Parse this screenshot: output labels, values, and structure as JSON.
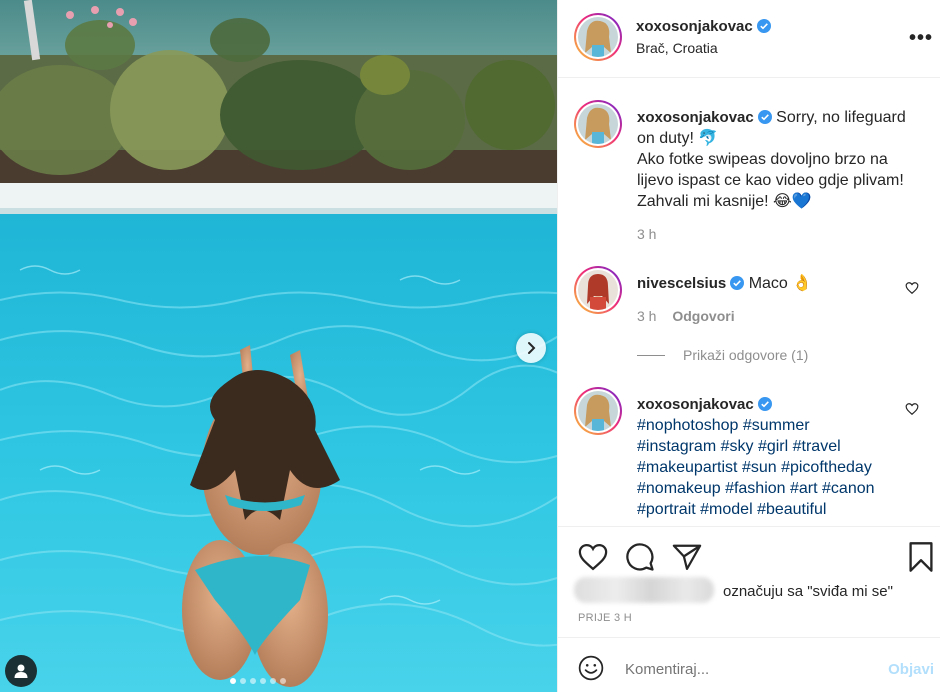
{
  "post": {
    "author": "xoxosonjakovac",
    "location": "Brač, Croatia",
    "more_label": "•••"
  },
  "caption": {
    "username": "xoxosonjakovac",
    "lines": [
      "Sorry, no lifeguard",
      "on duty! 🐬",
      "Ako fotke swipeas dovoljno brzo na",
      "lijevo ispast ce kao video gdje plivam!",
      "Zahvali mi kasnije! 😂💙"
    ],
    "time": "3 h"
  },
  "comment1": {
    "username": "nivescelsius",
    "text": "Maco 👌",
    "time": "3 h",
    "reply_label": "Odgovori"
  },
  "replies": {
    "label": "Prikaži odgovore (1)"
  },
  "comment2": {
    "username": "xoxosonjakovac",
    "tags_lines": [
      "#nophotoshop #summer",
      "#instagram #sky #girl #travel",
      "#makeupartist #sun #picoftheday",
      "#nomakeup #fashion #art #canon",
      "#portrait #model #beautiful"
    ]
  },
  "likes": {
    "text": "označuju sa \"sviđa mi se\""
  },
  "timestamp": "PRIJE 3 H",
  "add_comment": {
    "placeholder": "Komentiraj...",
    "post_label": "Objavi"
  },
  "carousel": {
    "total_slides": 6,
    "active_index": 0
  },
  "colors": {
    "pool": "#2bbfdc",
    "verified": "#3897f0",
    "hashtag": "#00376b",
    "post_disabled": "#b2dffc"
  }
}
